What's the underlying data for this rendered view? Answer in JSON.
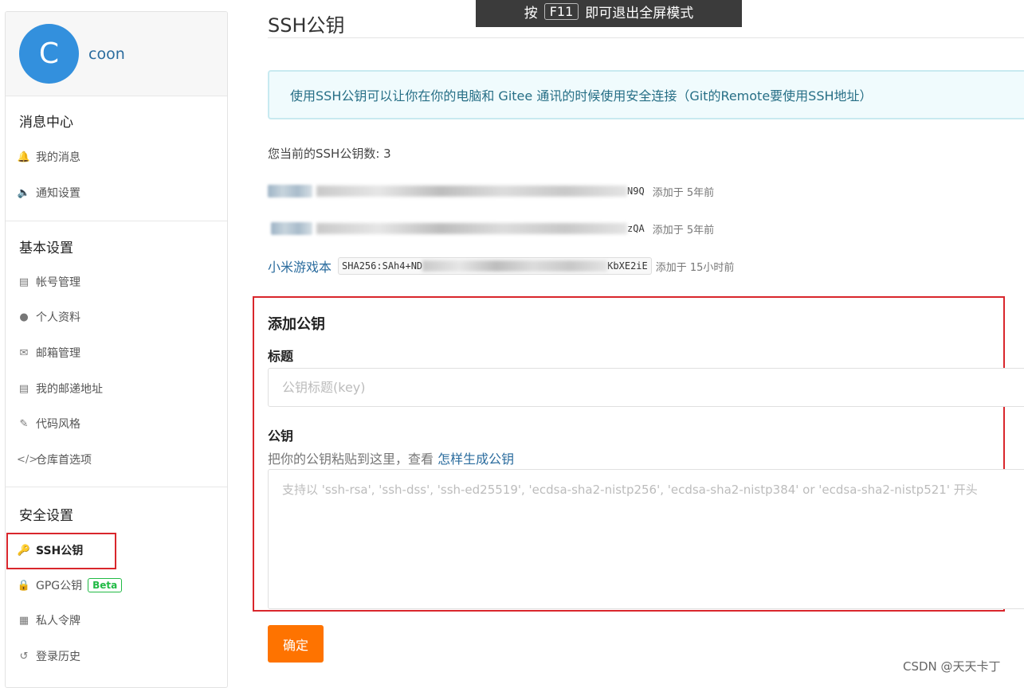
{
  "fullscreen_toast": {
    "prefix": "按",
    "key": "F11",
    "suffix": "即可退出全屏模式"
  },
  "profile": {
    "avatar_letter": "C",
    "username": "coon"
  },
  "sidebar": {
    "message_center": {
      "title": "消息中心",
      "items": [
        {
          "label": "我的消息",
          "icon": "bell-icon"
        },
        {
          "label": "通知设置",
          "icon": "speaker-icon"
        }
      ]
    },
    "basic_settings": {
      "title": "基本设置",
      "items": [
        {
          "label": "帐号管理",
          "icon": "id-card-icon"
        },
        {
          "label": "个人资料",
          "icon": "user-icon"
        },
        {
          "label": "邮箱管理",
          "icon": "envelope-icon"
        },
        {
          "label": "我的邮递地址",
          "icon": "address-card-icon"
        },
        {
          "label": "代码风格",
          "icon": "brush-icon"
        },
        {
          "label": "仓库首选项",
          "icon": "code-icon"
        }
      ]
    },
    "security_settings": {
      "title": "安全设置",
      "items": [
        {
          "label": "SSH公钥",
          "icon": "key-icon",
          "active": true
        },
        {
          "label": "GPG公钥",
          "icon": "lock-icon",
          "badge": "Beta"
        },
        {
          "label": "私人令牌",
          "icon": "token-icon"
        },
        {
          "label": "登录历史",
          "icon": "history-icon"
        }
      ]
    }
  },
  "main": {
    "title": "SSH公钥",
    "info": "使用SSH公钥可以让你在你的电脑和 Gitee 通讯的时候使用安全连接（Git的Remote要使用SSH地址）",
    "count_text": "您当前的SSH公钥数: 3",
    "keys": [
      {
        "name": "",
        "hash_start": "",
        "hash_end": "N9Q",
        "added": "添加于 5年前"
      },
      {
        "name": "",
        "hash_start": "",
        "hash_end": "zQA",
        "added": "添加于 5年前"
      },
      {
        "name": "小米游戏本",
        "hash_start": "SHA256:SAh4+ND",
        "hash_end": "KbXE2iE",
        "added": "添加于 15小时前"
      }
    ],
    "add_form": {
      "heading": "添加公钥",
      "title_label": "标题",
      "title_placeholder": "公钥标题(key)",
      "title_value": "",
      "key_label": "公钥",
      "key_hint": "把你的公钥粘贴到这里，查看",
      "key_hint_link": "怎样生成公钥",
      "key_placeholder": "支持以 'ssh-rsa', 'ssh-dss', 'ssh-ed25519', 'ecdsa-sha2-nistp256', 'ecdsa-sha2-nistp384' or 'ecdsa-sha2-nistp521' 开头",
      "key_value": "",
      "submit_label": "确定"
    }
  },
  "watermark": "CSDN @天天卡丁",
  "colors": {
    "accent": "#fe7300",
    "link": "#2b6c9e",
    "highlight_border": "#d9262c",
    "beta": "#21ba45"
  }
}
